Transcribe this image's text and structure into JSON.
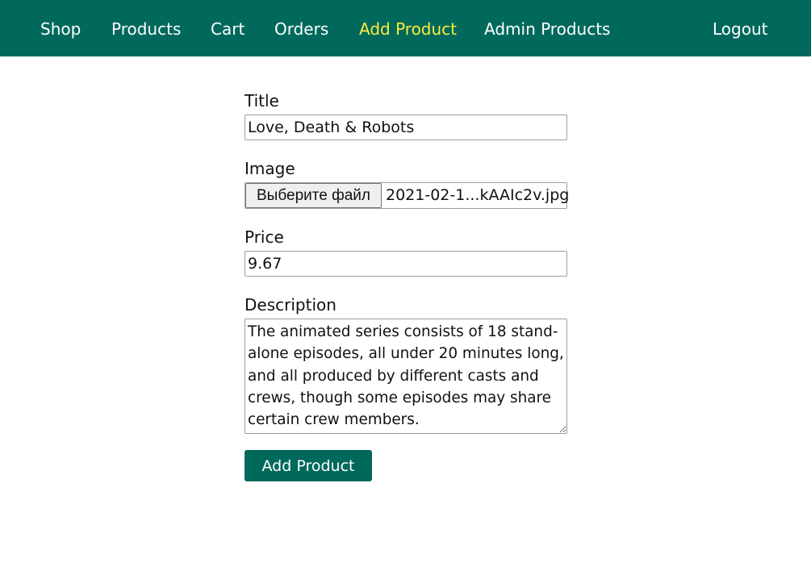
{
  "nav": {
    "items": [
      {
        "label": "Shop"
      },
      {
        "label": "Products"
      },
      {
        "label": "Cart"
      },
      {
        "label": "Orders"
      },
      {
        "label": "Add Product"
      },
      {
        "label": "Admin Products"
      }
    ],
    "active": "Add Product",
    "logout_label": "Logout"
  },
  "form": {
    "title_label": "Title",
    "title_value": "Love, Death & Robots",
    "image_label": "Image",
    "image_button_label": "Выберите файл",
    "image_file_name": "2021-02-1...kAAIc2v.jpg",
    "price_label": "Price",
    "price_value": "9.67",
    "description_label": "Description",
    "description_value": "The animated series consists of 18 stand-alone episodes, all under 20 minutes long, and all produced by different casts and crews, though some episodes may share certain crew members.",
    "submit_label": "Add Product"
  },
  "colors": {
    "header_bg": "#00695c",
    "nav_text": "#ffffff",
    "nav_active": "#ffeb3b",
    "button_bg": "#00695c"
  }
}
